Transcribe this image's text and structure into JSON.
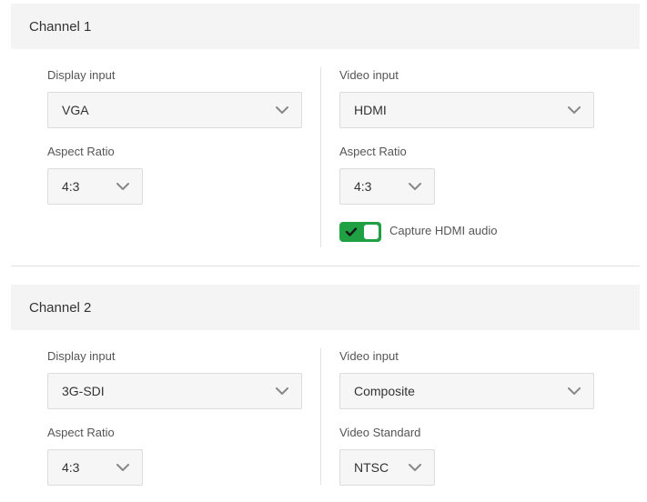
{
  "channel1": {
    "title": "Channel 1",
    "display_input": {
      "label": "Display input",
      "value": "VGA"
    },
    "display_aspect": {
      "label": "Aspect Ratio",
      "value": "4:3"
    },
    "video_input": {
      "label": "Video input",
      "value": "HDMI"
    },
    "video_aspect": {
      "label": "Aspect Ratio",
      "value": "4:3"
    },
    "capture_audio": {
      "label": "Capture HDMI audio",
      "enabled": true
    }
  },
  "channel2": {
    "title": "Channel 2",
    "display_input": {
      "label": "Display input",
      "value": "3G-SDI"
    },
    "display_aspect": {
      "label": "Aspect Ratio",
      "value": "4:3"
    },
    "video_input": {
      "label": "Video input",
      "value": "Composite"
    },
    "video_standard": {
      "label": "Video Standard",
      "value": "NTSC"
    }
  },
  "colors": {
    "toggle_on": "#1fa143",
    "header_bg": "#f4f4f4",
    "select_bg": "#f6f6f6",
    "chevron": "#888888"
  },
  "icons": {
    "dropdown": "chevron-down-icon",
    "toggle_check": "checkmark-icon"
  }
}
